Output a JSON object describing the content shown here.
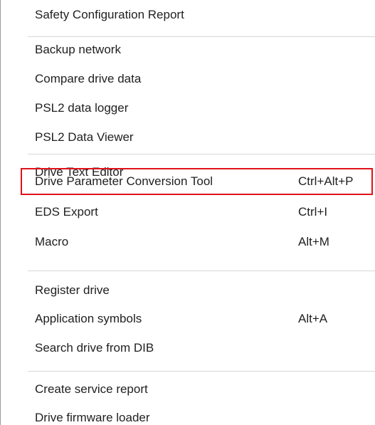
{
  "menu": {
    "items": [
      {
        "label": "Safety Configuration Report",
        "shortcut": ""
      },
      {
        "label": "Backup network",
        "shortcut": ""
      },
      {
        "label": "Compare drive data",
        "shortcut": ""
      },
      {
        "label": "PSL2 data logger",
        "shortcut": ""
      },
      {
        "label": "PSL2 Data Viewer",
        "shortcut": ""
      },
      {
        "label": "Drive Text Editor",
        "shortcut": ""
      },
      {
        "label": "Drive Parameter Conversion Tool",
        "shortcut": "Ctrl+Alt+P"
      },
      {
        "label": "EDS Export",
        "shortcut": "Ctrl+I"
      },
      {
        "label": "Macro",
        "shortcut": "Alt+M"
      },
      {
        "label": "Register drive",
        "shortcut": ""
      },
      {
        "label": "Application symbols",
        "shortcut": "Alt+A"
      },
      {
        "label": "Search drive from DIB",
        "shortcut": ""
      },
      {
        "label": "Create service report",
        "shortcut": ""
      },
      {
        "label": "Drive firmware loader",
        "shortcut": ""
      }
    ],
    "highlight_color": "#e0121a",
    "separator_color": "#d7d7d7"
  }
}
